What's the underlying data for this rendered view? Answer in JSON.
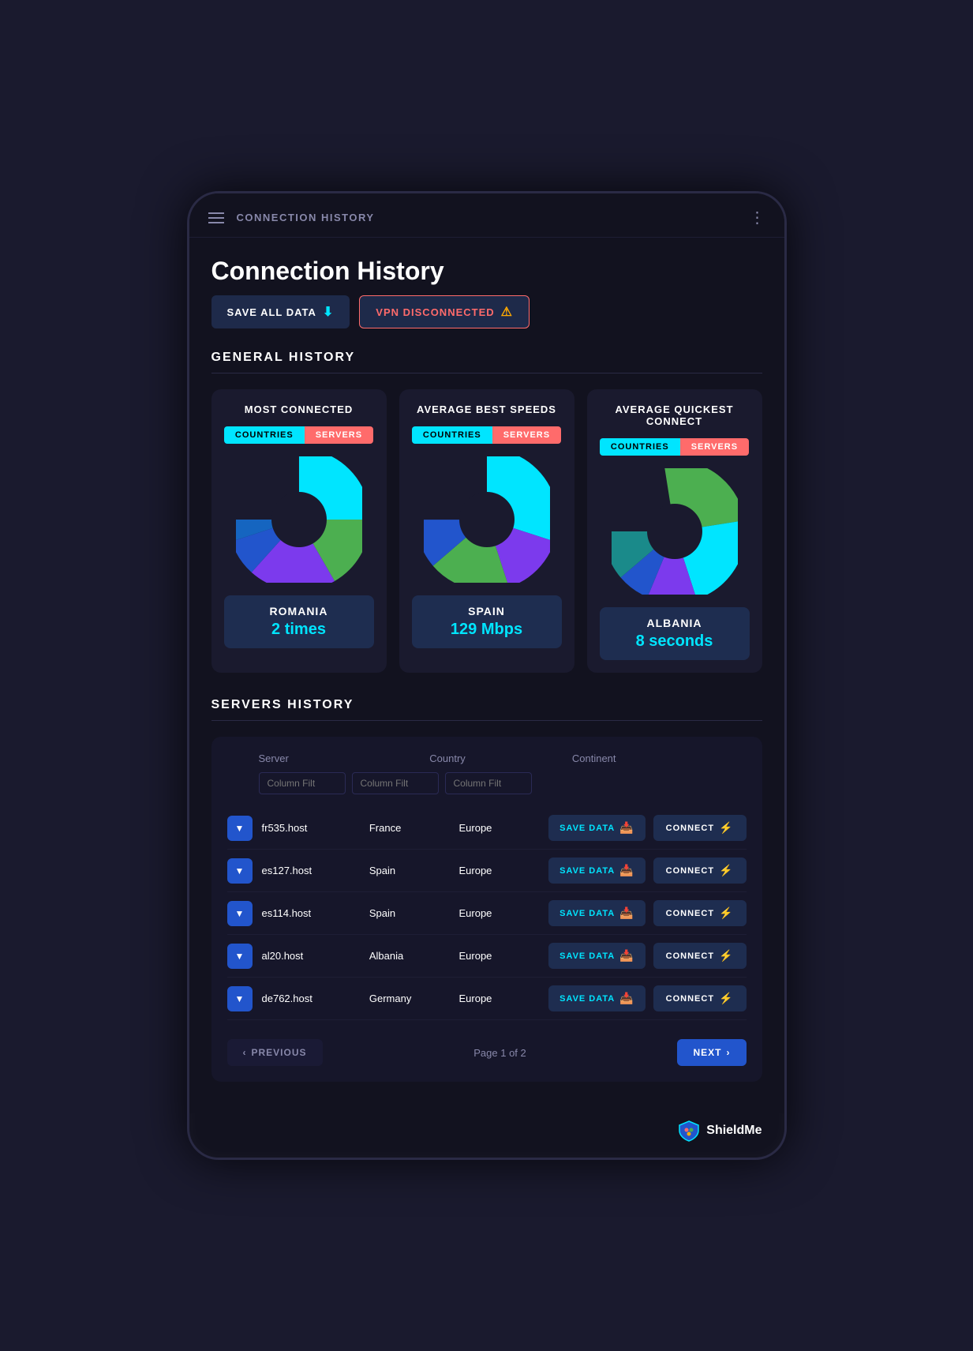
{
  "topBar": {
    "title": "CONNECTION HISTORY",
    "moreIcon": "⋮"
  },
  "pageTitle": "Connection History",
  "buttons": {
    "saveAll": "SAVE ALL DATA",
    "vpnStatus": "VPN DISCONNECTED"
  },
  "sections": {
    "generalHistory": "GENERAL HISTORY",
    "serversHistory": "SERVERS HISTORY"
  },
  "charts": [
    {
      "title": "MOST CONNECTED",
      "tab1": "COUNTRIES",
      "tab2": "SERVERS",
      "bottomLabel": "ROMANIA",
      "bottomValue": "2 times",
      "pieColors": [
        "#00e5ff",
        "#4CAF50",
        "#7c3aed",
        "#2255cc",
        "#1565c0"
      ]
    },
    {
      "title": "AVERAGE BEST SPEEDS",
      "tab1": "COUNTRIES",
      "tab2": "SERVERS",
      "bottomLabel": "SPAIN",
      "bottomValue": "129 Mbps",
      "pieColors": [
        "#00e5ff",
        "#7c3aed",
        "#4CAF50",
        "#2255cc",
        "#1565c0"
      ]
    },
    {
      "title": "AVERAGE QUICKEST CONNECT",
      "tab1": "COUNTRIES",
      "tab2": "SERVERS",
      "bottomLabel": "ALBANIA",
      "bottomValue": "8 seconds",
      "pieColors": [
        "#4CAF50",
        "#00e5ff",
        "#7c3aed",
        "#2255cc",
        "#1a8a8a"
      ]
    }
  ],
  "tableHeaders": {
    "server": "Server",
    "country": "Country",
    "continent": "Continent"
  },
  "filters": {
    "serverFilter": "Column Filt",
    "countryFilter": "Column Filt",
    "continentFilter": "Column Filt"
  },
  "servers": [
    {
      "id": "fr535.host",
      "country": "France",
      "continent": "Europe"
    },
    {
      "id": "es127.host",
      "country": "Spain",
      "continent": "Europe"
    },
    {
      "id": "es114.host",
      "country": "Spain",
      "continent": "Europe"
    },
    {
      "id": "al20.host",
      "country": "Albania",
      "continent": "Europe"
    },
    {
      "id": "de762.host",
      "country": "Germany",
      "continent": "Europe"
    }
  ],
  "rowButtons": {
    "saveData": "SAVE DATA",
    "connect": "CONNECT"
  },
  "pagination": {
    "prev": "PREVIOUS",
    "next": "NEXT",
    "pageInfo": "Page 1 of 2"
  },
  "footer": {
    "brand": "ShieldMe"
  }
}
